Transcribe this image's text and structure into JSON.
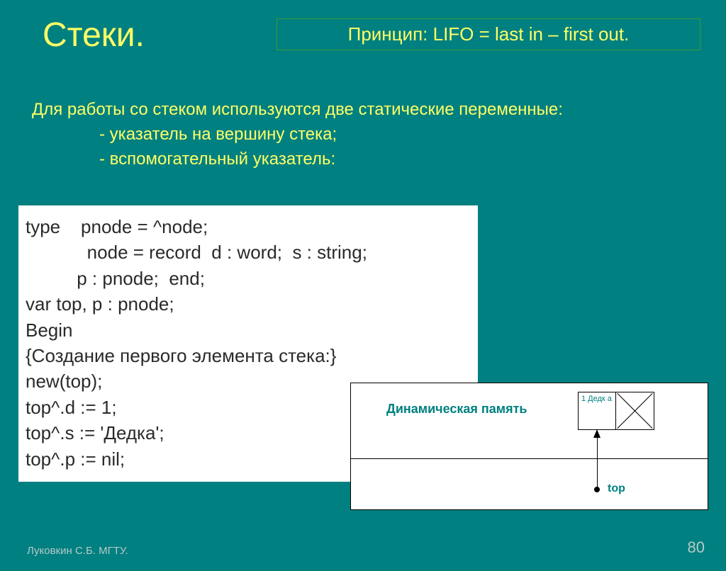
{
  "title": "Стеки.",
  "principle": "Принцип: LIFO = last in – first out.",
  "intro": {
    "line1": "Для работы со стеком используются две статические переменные:",
    "line2": "- указатель на вершину стека;",
    "line3": "- вспомогательный указатель:"
  },
  "code": "type    pnode = ^node;\n            node = record  d : word;  s : string;\n          p : pnode;  end;\nvar top, p : pnode;\nBegin\n{Создание первого элемента стека:}\nnew(top);\ntop^.d := 1;\ntop^.s := 'Дедка';\ntop^.p := nil;",
  "diagram": {
    "memory_label": "Динамическая\nпамять",
    "node_text": "1\nДедк\nа",
    "top_label": "top"
  },
  "footer": {
    "author": "Луковкин С.Б. МГТУ.",
    "page": "80"
  }
}
